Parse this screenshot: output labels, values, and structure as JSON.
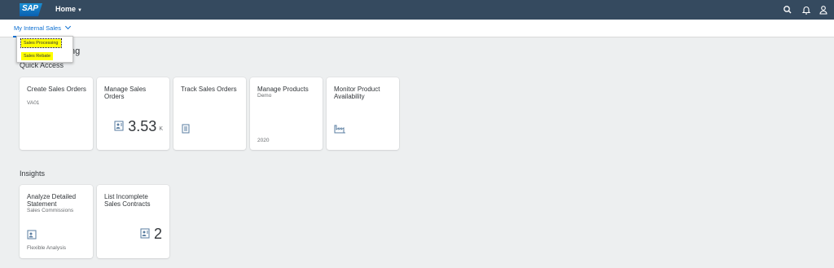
{
  "shell": {
    "logo_text": "SAP",
    "home_label": "Home",
    "icons": [
      "search-icon",
      "bell-icon",
      "user-icon"
    ]
  },
  "group_select": {
    "label": "My Internal Sales"
  },
  "dropdown": {
    "items": [
      "Sales Processing",
      "Sales Rebate"
    ]
  },
  "page_title_fragment": "ng",
  "sections": {
    "quick_access": "Quick Access",
    "insights": "Insights"
  },
  "tiles": {
    "create_sales_orders": {
      "title": "Create Sales Orders",
      "subtitle": "VA01"
    },
    "manage_sales_orders": {
      "title": "Manage Sales Orders",
      "kpi_value": "3.53",
      "kpi_unit": "K",
      "icon": "document-contact-icon"
    },
    "track_sales_orders": {
      "title": "Track Sales Orders",
      "icon": "document-list-icon"
    },
    "manage_products": {
      "title": "Manage Products",
      "subtitle": "Demo",
      "footer": "2020"
    },
    "monitor_product_availability": {
      "title": "Monitor Product Availability",
      "icon": "factory-icon"
    },
    "analyze_detailed_statement": {
      "title": "Analyze Detailed Statement",
      "subtitle": "Sales Commissions",
      "footer": "Flexible Analysis",
      "icon": "document-contact-icon"
    },
    "list_incomplete_sales_contracts": {
      "title": "List Incomplete Sales Contracts",
      "kpi_value": "2",
      "icon": "document-contact-icon"
    }
  },
  "colors": {
    "shell_bg": "#354a5f",
    "accent": "#0a6ed1",
    "highlight": "#fffe00",
    "page_bg": "#edeff0"
  }
}
